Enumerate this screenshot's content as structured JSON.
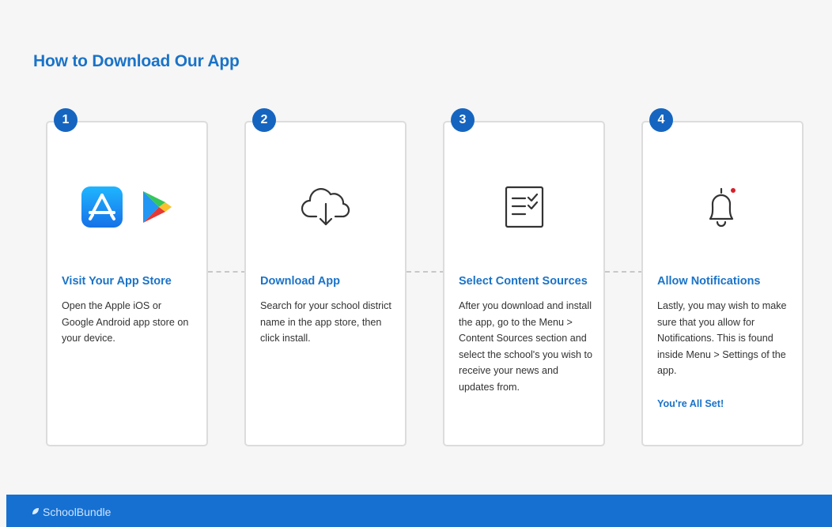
{
  "page": {
    "title": "How to Download Our App"
  },
  "steps": [
    {
      "number": "1",
      "title": "Visit Your App Store",
      "description": "Open the Apple iOS or Google Android app store on your device.",
      "icons": [
        "app-store-icon",
        "google-play-icon"
      ]
    },
    {
      "number": "2",
      "title": "Download App",
      "description": "Search for your school district name in the app store, then click install.",
      "icons": [
        "cloud-download-icon"
      ]
    },
    {
      "number": "3",
      "title": "Select Content Sources",
      "description": "After you download and install the app, go to the Menu > Content Sources section and select the school's you wish to receive your news and updates from.",
      "icons": [
        "checklist-icon"
      ]
    },
    {
      "number": "4",
      "title": "Allow Notifications",
      "description": "Lastly, you may wish to make sure that you allow for Notifications. This is found inside Menu > Settings of the app.",
      "extra": "You're All Set!",
      "icons": [
        "bell-icon"
      ]
    }
  ],
  "footer": {
    "brand": "SchoolBundle"
  },
  "colors": {
    "accent": "#1a73c8",
    "badge": "#1565c0",
    "footer": "#1570d2",
    "notification_dot": "#d6202a"
  }
}
